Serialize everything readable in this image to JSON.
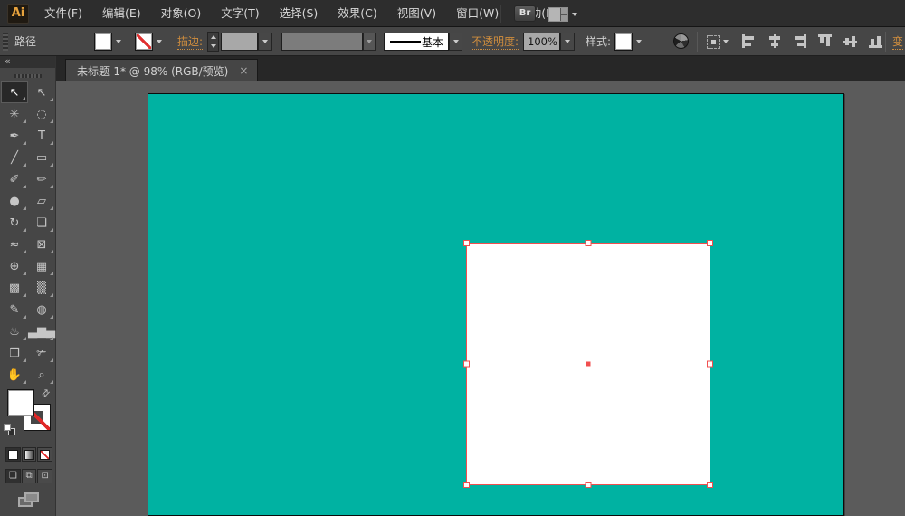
{
  "colors": {
    "artboard_teal": "#00b2a2",
    "selection_red": "#f14f4f",
    "accent_orange": "#cf8d3e",
    "panel": "#464646",
    "menubar": "#2d2d2d",
    "pasteboard": "#5b5b5b"
  },
  "menu_bar": {
    "logo": "Ai",
    "items": [
      {
        "name": "menu-file",
        "label": "文件(F)"
      },
      {
        "name": "menu-edit",
        "label": "编辑(E)"
      },
      {
        "name": "menu-object",
        "label": "对象(O)"
      },
      {
        "name": "menu-type",
        "label": "文字(T)"
      },
      {
        "name": "menu-select",
        "label": "选择(S)"
      },
      {
        "name": "menu-effect",
        "label": "效果(C)"
      },
      {
        "name": "menu-view",
        "label": "视图(V)"
      },
      {
        "name": "menu-window",
        "label": "窗口(W)"
      },
      {
        "name": "menu-help",
        "label": "帮助(H)"
      }
    ],
    "bridge_button": "Br"
  },
  "control_bar": {
    "context_label": "路径",
    "stroke_link": "描边:",
    "stroke_width_value": "",
    "brush_value": "",
    "variable_width_profile": "基本",
    "opacity_link": "不透明度:",
    "opacity_value": "100%",
    "style_label": "样式:",
    "transform_link": "变",
    "align_icons": [
      {
        "name": "horizontal-align-left-icon",
        "cls": "al-left"
      },
      {
        "name": "horizontal-align-center-icon",
        "cls": "al-center"
      },
      {
        "name": "horizontal-align-right-icon",
        "cls": "al-right"
      },
      {
        "name": "vertical-align-top-icon",
        "cls": "al-left al-rot"
      },
      {
        "name": "vertical-align-center-icon",
        "cls": "al-center al-rot"
      },
      {
        "name": "vertical-align-bottom-icon",
        "cls": "al-right al-rot"
      }
    ]
  },
  "tab_bar": {
    "tabs": [
      {
        "title": "未标题-1* @ 98% (RGB/预览)",
        "close": "×",
        "active": true
      }
    ]
  },
  "toolbar": {
    "collapse_glyph": "«",
    "tools": [
      {
        "name": "selection-tool",
        "glyph": "↖",
        "active": true
      },
      {
        "name": "direct-selection-tool",
        "glyph": "↖"
      },
      {
        "name": "magic-wand-tool",
        "glyph": "✳"
      },
      {
        "name": "lasso-tool",
        "glyph": "◌"
      },
      {
        "name": "pen-tool",
        "glyph": "✒"
      },
      {
        "name": "type-tool",
        "glyph": "T"
      },
      {
        "name": "line-segment-tool",
        "glyph": "╱"
      },
      {
        "name": "rectangle-tool",
        "glyph": "▭"
      },
      {
        "name": "paintbrush-tool",
        "glyph": "✐"
      },
      {
        "name": "pencil-tool",
        "glyph": "✏"
      },
      {
        "name": "blob-brush-tool",
        "glyph": "●"
      },
      {
        "name": "eraser-tool",
        "glyph": "▱"
      },
      {
        "name": "rotate-tool",
        "glyph": "↻"
      },
      {
        "name": "scale-tool",
        "glyph": "❏"
      },
      {
        "name": "width-tool",
        "glyph": "≈"
      },
      {
        "name": "free-transform-tool",
        "glyph": "⊠"
      },
      {
        "name": "shape-builder-tool",
        "glyph": "⊕"
      },
      {
        "name": "perspective-grid-tool",
        "glyph": "▦"
      },
      {
        "name": "mesh-tool",
        "glyph": "▩"
      },
      {
        "name": "gradient-tool",
        "glyph": "▒"
      },
      {
        "name": "eyedropper-tool",
        "glyph": "✎"
      },
      {
        "name": "blend-tool",
        "glyph": "◍"
      },
      {
        "name": "symbol-sprayer-tool",
        "glyph": "♨"
      },
      {
        "name": "column-graph-tool",
        "glyph": "▃▆▄"
      },
      {
        "name": "artboard-tool",
        "glyph": "❒"
      },
      {
        "name": "slice-tool",
        "glyph": "✃"
      },
      {
        "name": "hand-tool",
        "glyph": "✋"
      },
      {
        "name": "zoom-tool",
        "glyph": "⌕"
      }
    ],
    "drawing_modes": [
      {
        "name": "draw-normal-mode-button",
        "glyph": "❏",
        "active": true
      },
      {
        "name": "draw-behind-mode-button",
        "glyph": "⧉"
      },
      {
        "name": "draw-inside-mode-button",
        "glyph": "⊡"
      }
    ]
  }
}
